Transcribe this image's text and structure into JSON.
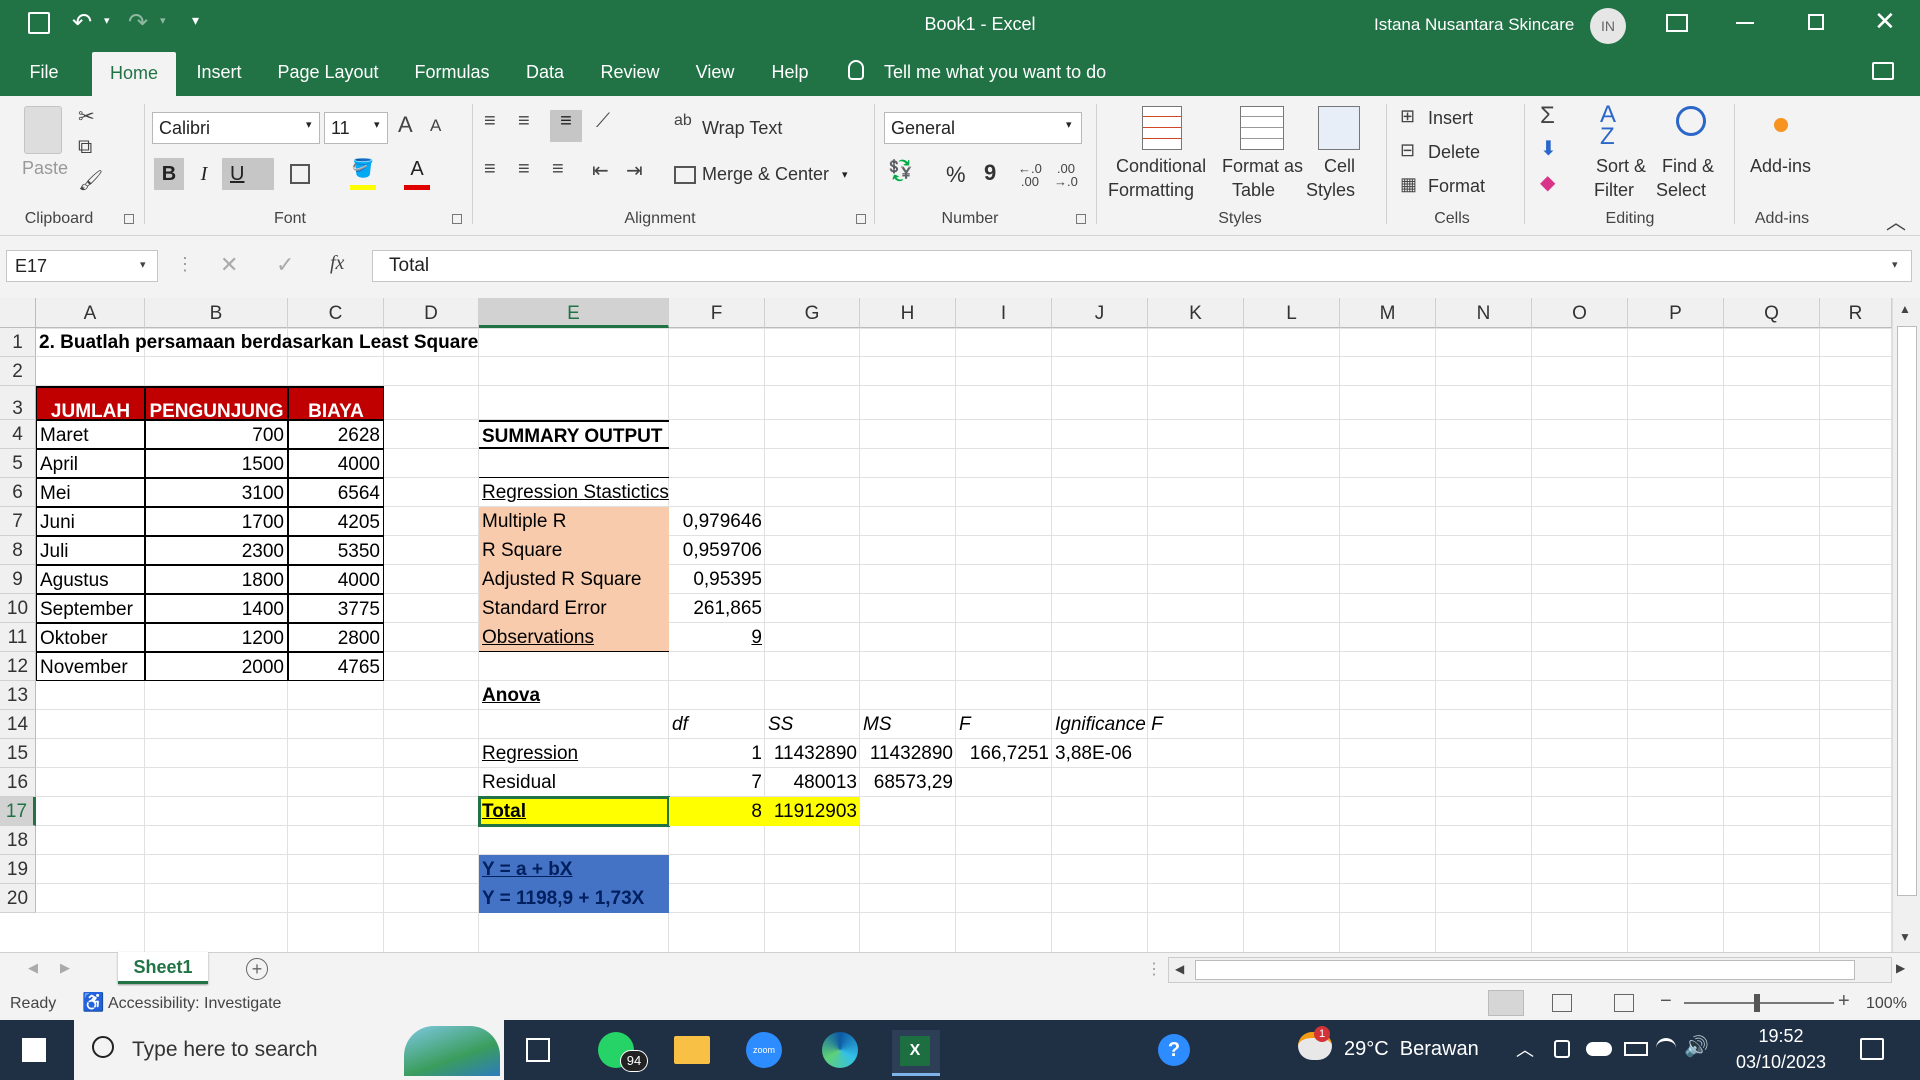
{
  "window": {
    "title": "Book1  -  Excel",
    "user_name": "Istana Nusantara Skincare",
    "user_initials": "IN"
  },
  "tabs": [
    "File",
    "Home",
    "Insert",
    "Page Layout",
    "Formulas",
    "Data",
    "Review",
    "View",
    "Help"
  ],
  "active_tab": "Home",
  "tell_me": "Tell me what you want to do",
  "ribbon": {
    "clipboard": {
      "paste": "Paste",
      "label": "Clipboard"
    },
    "font": {
      "name": "Calibri",
      "size": "11",
      "label": "Font",
      "bold": "B",
      "italic": "I",
      "underline": "U"
    },
    "alignment": {
      "wrap": "Wrap Text",
      "merge": "Merge & Center",
      "label": "Alignment"
    },
    "number": {
      "format": "General",
      "label": "Number",
      "percent": "%",
      "comma": "9"
    },
    "styles": {
      "conditional_1": "Conditional",
      "conditional_2": "Formatting",
      "format_as_1": "Format as",
      "format_as_2": "Table",
      "cell_1": "Cell",
      "cell_2": "Styles",
      "label": "Styles"
    },
    "cells": {
      "insert": "Insert",
      "delete": "Delete",
      "format": "Format",
      "label": "Cells"
    },
    "editing": {
      "sort_1": "Sort &",
      "sort_2": "Filter",
      "find_1": "Find &",
      "find_2": "Select",
      "label": "Editing"
    },
    "addins": {
      "button": "Add-ins",
      "label": "Add-ins"
    }
  },
  "formula_bar": {
    "name_box": "E17",
    "fx": "fx",
    "content": "Total"
  },
  "columns": [
    "A",
    "B",
    "C",
    "D",
    "E",
    "F",
    "G",
    "H",
    "I",
    "J",
    "K",
    "L",
    "M",
    "N",
    "O",
    "P",
    "Q",
    "R"
  ],
  "rows": [
    "1",
    "2",
    "3",
    "4",
    "5",
    "6",
    "7",
    "8",
    "9",
    "10",
    "11",
    "12",
    "13",
    "14",
    "15",
    "16",
    "17",
    "18",
    "19",
    "20"
  ],
  "sheet": {
    "heading": "2. Buatlah persamaan berdasarkan Least Square",
    "table_headers": [
      "JUMLAH",
      "PENGUNJUNG",
      "BIAYA"
    ],
    "table_rows": [
      [
        "Maret",
        "700",
        "2628"
      ],
      [
        "April",
        "1500",
        "4000"
      ],
      [
        "Mei",
        "3100",
        "6564"
      ],
      [
        "Juni",
        "1700",
        "4205"
      ],
      [
        "Juli",
        "2300",
        "5350"
      ],
      [
        "Agustus",
        "1800",
        "4000"
      ],
      [
        "September",
        "1400",
        "3775"
      ],
      [
        "Oktober",
        "1200",
        "2800"
      ],
      [
        "November",
        "2000",
        "4765"
      ]
    ],
    "summary_output": "SUMMARY OUTPUT",
    "regression_statistics": "Regression Stastictics",
    "stats": [
      [
        "Multiple R",
        "0,979646"
      ],
      [
        "R Square",
        "0,959706"
      ],
      [
        "Adjusted R Square",
        "0,95395"
      ],
      [
        "Standard Error",
        "261,865"
      ],
      [
        "Observations",
        "9"
      ]
    ],
    "anova": "Anova",
    "anova_headers": [
      "df",
      "SS",
      "MS",
      "F",
      "Ignificance F"
    ],
    "anova_rows": [
      [
        "Regression",
        "1",
        "11432890",
        "11432890",
        "166,7251",
        "3,88E-06"
      ],
      [
        "Residual",
        "7",
        "480013",
        "68573,29",
        "",
        ""
      ],
      [
        "Total",
        "8",
        "11912903",
        "",
        "",
        ""
      ]
    ],
    "equation_1": "Y = a + bX",
    "equation_2": "Y = 1198,9 + 1,73X"
  },
  "sheet_tab": "Sheet1",
  "status": {
    "ready": "Ready",
    "accessibility": "Accessibility: Investigate",
    "zoom": "100%"
  },
  "taskbar": {
    "search": "Type here to search",
    "whatsapp_badge": "94",
    "zoom_label": "zoom",
    "weather": "29°C  Berawan",
    "time": "19:52",
    "date": "03/10/2023",
    "notification": "1"
  },
  "colors": {
    "excel_green": "#217346",
    "header_red": "#c00000",
    "stats_fill": "#f8cbad",
    "total_fill": "#ffff00",
    "equation_fill": "#4472c4"
  }
}
